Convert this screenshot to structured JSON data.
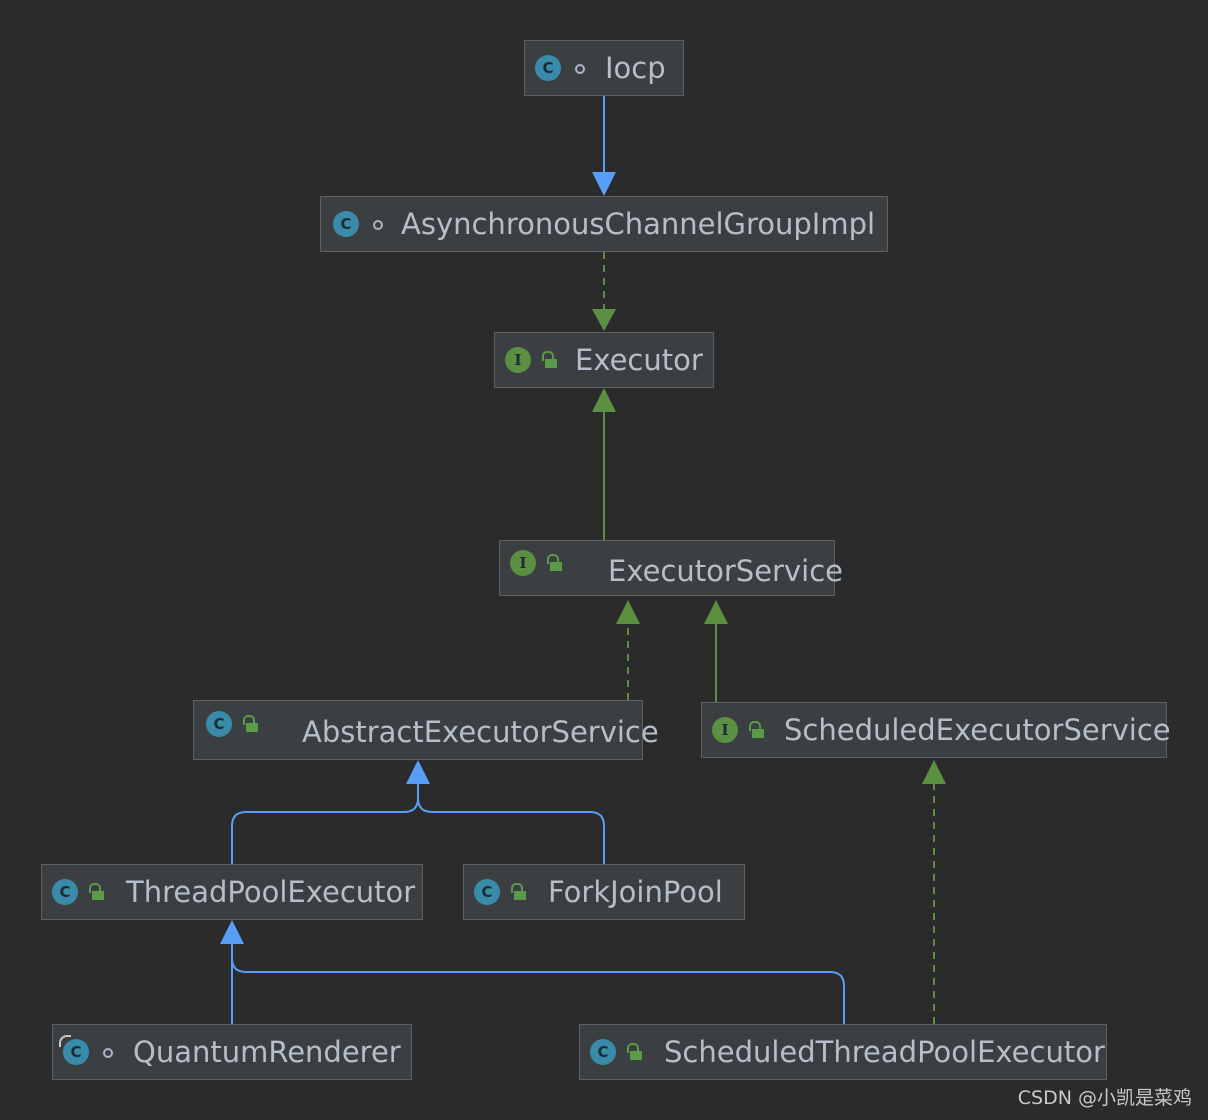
{
  "nodes": {
    "iocp": {
      "label": "Iocp"
    },
    "acgi": {
      "label": "AsynchronousChannelGroupImpl"
    },
    "executor": {
      "label": "Executor"
    },
    "executor_service": {
      "label": "ExecutorService"
    },
    "abstract_executor_service": {
      "label": "AbstractExecutorService"
    },
    "scheduled_executor_service": {
      "label": "ScheduledExecutorService"
    },
    "thread_pool_executor": {
      "label": "ThreadPoolExecutor"
    },
    "fork_join_pool": {
      "label": "ForkJoinPool"
    },
    "quantum_renderer": {
      "label": "QuantumRenderer"
    },
    "scheduled_thread_pool_executor": {
      "label": "ScheduledThreadPoolExecutor"
    }
  },
  "edges": [
    {
      "from": "Iocp",
      "to": "AsynchronousChannelGroupImpl",
      "relation": "extends"
    },
    {
      "from": "AsynchronousChannelGroupImpl",
      "to": "Executor",
      "relation": "implements"
    },
    {
      "from": "ExecutorService",
      "to": "Executor",
      "relation": "extends"
    },
    {
      "from": "AbstractExecutorService",
      "to": "ExecutorService",
      "relation": "implements"
    },
    {
      "from": "ScheduledExecutorService",
      "to": "ExecutorService",
      "relation": "extends"
    },
    {
      "from": "ThreadPoolExecutor",
      "to": "AbstractExecutorService",
      "relation": "extends"
    },
    {
      "from": "ForkJoinPool",
      "to": "AbstractExecutorService",
      "relation": "extends"
    },
    {
      "from": "QuantumRenderer",
      "to": "ThreadPoolExecutor",
      "relation": "extends"
    },
    {
      "from": "ScheduledThreadPoolExecutor",
      "to": "ThreadPoolExecutor",
      "relation": "extends"
    },
    {
      "from": "ScheduledThreadPoolExecutor",
      "to": "ScheduledExecutorService",
      "relation": "implements"
    }
  ],
  "colors": {
    "background": "#2b2b2b",
    "extends_edge": "#589df6",
    "implements_edge": "#5b8f42",
    "class_icon": "#3a8ba9",
    "interface_icon": "#5b8f42"
  },
  "icons": {
    "class": "C",
    "interface": "I"
  },
  "watermark": "CSDN @小凯是菜鸡"
}
